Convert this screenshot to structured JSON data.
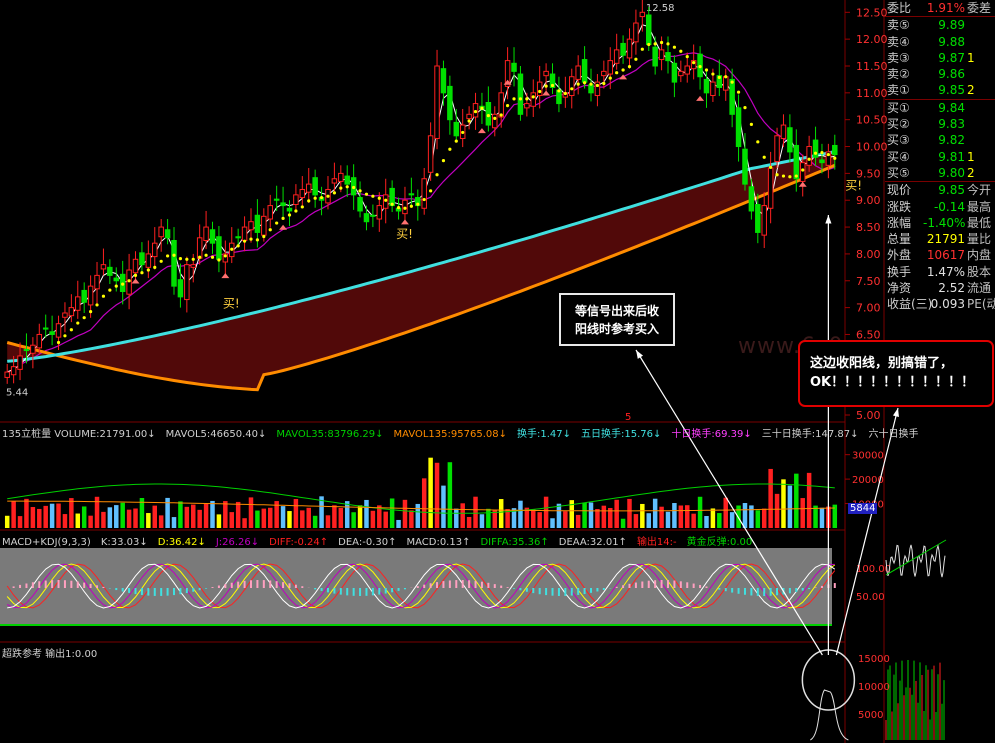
{
  "colors": {
    "up": "#ff2020",
    "down": "#00e000",
    "ma_white": "#ffffff",
    "ma_yellow": "#ffff00",
    "ma_cyan": "#40e0e0",
    "ma_orange": "#ff8c00",
    "ma_magenta": "#c000c0",
    "band_fill": "#5a0a0a",
    "macd_bg": "#7a7a7a"
  },
  "chart_data": [
    {
      "type": "line",
      "panel": "price",
      "y_axis_ticks": [
        "12.50",
        "12.00",
        "11.50",
        "11.00",
        "10.50",
        "10.00",
        "9.50",
        "9.00",
        "8.50",
        "8.00",
        "7.50",
        "7.00",
        "6.50",
        "6.00",
        "5.50",
        "5.00"
      ],
      "ylim": [
        5.0,
        12.58
      ],
      "high_label": "12.58",
      "low_label": "5.44",
      "n_bars": 139,
      "series": [
        {
          "values": [
            5.8,
            5.9,
            6.1,
            6.2,
            6.3,
            6.5,
            6.6,
            6.5,
            6.7,
            6.9,
            7.0,
            7.2,
            7.1,
            7.4,
            7.6,
            7.8,
            7.6,
            7.5,
            7.3,
            7.7,
            7.9,
            7.8,
            8.0,
            8.2,
            8.5,
            8.3,
            7.4,
            7.2,
            7.8,
            7.8,
            8.3,
            8.5,
            8.2,
            7.9,
            8.0,
            8.2,
            8.3,
            8.5,
            8.6,
            8.4,
            8.7,
            8.9,
            9.0,
            8.9,
            8.8,
            9.1,
            9.2,
            9.3,
            9.1,
            9.0,
            9.2,
            9.4,
            9.5,
            9.3,
            9.1,
            8.8,
            8.6,
            8.7,
            8.9,
            9.1,
            8.9,
            8.8,
            9.0,
            9.1,
            8.9,
            9.4,
            10.2,
            11.5,
            11.0,
            10.5,
            10.2,
            10.4,
            10.6,
            10.8,
            10.7,
            10.4,
            10.6,
            11.0,
            11.6,
            11.4,
            10.6,
            10.8,
            11.0,
            11.2,
            11.4,
            11.1,
            10.8,
            11.0,
            11.3,
            11.5,
            11.2,
            11.0,
            11.2,
            11.4,
            11.6,
            11.8,
            11.7,
            12.0,
            12.3,
            12.5,
            11.9,
            11.5,
            11.8,
            11.6,
            11.2,
            11.4,
            11.5,
            11.6,
            11.3,
            11.0,
            11.2,
            11.1,
            11.3,
            10.6,
            10.0,
            9.3,
            8.8,
            8.4,
            8.9,
            9.6,
            10.2,
            10.4,
            9.9,
            9.4,
            9.7,
            10.0,
            9.8,
            9.7,
            9.9,
            9.85
          ]
        }
      ],
      "annotations": [
        "买!",
        "买!",
        "买!"
      ]
    },
    {
      "type": "bar",
      "panel": "volume",
      "y_axis_ticks": [
        "30000",
        "20000",
        "10000"
      ]
    },
    {
      "type": "line",
      "panel": "macd_kdj",
      "y_axis_ticks": [
        "100.00",
        "50.00"
      ]
    }
  ],
  "quote": {
    "rows": [
      {
        "label": "委比",
        "value": "1.91%",
        "extra": "委差",
        "vcolor": "red"
      },
      {
        "label": "卖⑤",
        "value": "9.89",
        "extra": "",
        "vcolor": "green"
      },
      {
        "label": "卖④",
        "value": "9.88",
        "extra": "",
        "vcolor": "green"
      },
      {
        "label": "卖③",
        "value": "9.87",
        "extra": "1",
        "vcolor": "green"
      },
      {
        "label": "卖②",
        "value": "9.86",
        "extra": "",
        "vcolor": "green"
      },
      {
        "label": "卖①",
        "value": "9.85",
        "extra": "2",
        "vcolor": "green"
      },
      {
        "label": "买①",
        "value": "9.84",
        "extra": "",
        "vcolor": "green"
      },
      {
        "label": "买②",
        "value": "9.83",
        "extra": "",
        "vcolor": "green"
      },
      {
        "label": "买③",
        "value": "9.82",
        "extra": "",
        "vcolor": "green"
      },
      {
        "label": "买④",
        "value": "9.81",
        "extra": "1",
        "vcolor": "green"
      },
      {
        "label": "买⑤",
        "value": "9.80",
        "extra": "2",
        "vcolor": "green"
      },
      {
        "label": "现价",
        "value": "9.85",
        "extra": "今开",
        "vcolor": "green"
      },
      {
        "label": "涨跌",
        "value": "-0.14",
        "extra": "最高",
        "vcolor": "green"
      },
      {
        "label": "涨幅",
        "value": "-1.40%",
        "extra": "最低",
        "vcolor": "green"
      },
      {
        "label": "总量",
        "value": "21791",
        "extra": "量比",
        "vcolor": "yellow"
      },
      {
        "label": "外盘",
        "value": "10617",
        "extra": "内盘",
        "vcolor": "red"
      },
      {
        "label": "换手",
        "value": "1.47%",
        "extra": "股本",
        "vcolor": "white"
      },
      {
        "label": "净资",
        "value": "2.52",
        "extra": "流通",
        "vcolor": "white"
      },
      {
        "label": "收益(三)",
        "value": "0.093",
        "extra": "PE(动",
        "vcolor": "white"
      }
    ]
  },
  "volume_header": [
    {
      "text": "135立桩量 VOLUME:21791.00↓",
      "color": "#d0d0d0"
    },
    {
      "text": "MAVOL5:46650.40↓",
      "color": "#d0d0d0"
    },
    {
      "text": "MAVOL35:83796.29↓",
      "color": "#00d000"
    },
    {
      "text": "MAVOL135:95765.08↓",
      "color": "#ff8c00"
    },
    {
      "text": "换手:1.47↓",
      "color": "#40e0e0"
    },
    {
      "text": "五日换手:15.76↓",
      "color": "#40e0e0"
    },
    {
      "text": "十日换手:69.39↓",
      "color": "#ff40ff"
    },
    {
      "text": "三十日换手:147.87↓",
      "color": "#d0d0d0"
    },
    {
      "text": "六十日换手",
      "color": "#d0d0d0"
    }
  ],
  "macd_header": [
    {
      "text": "MACD+KDJ(9,3,3)",
      "color": "#d0d0d0"
    },
    {
      "text": "K:33.03↓",
      "color": "#d0d0d0"
    },
    {
      "text": "D:36.42↓",
      "color": "#ffff00"
    },
    {
      "text": "J:26.26↓",
      "color": "#c000c0"
    },
    {
      "text": "DIFF:-0.24↑",
      "color": "#ff2020"
    },
    {
      "text": "DEA:-0.30↑",
      "color": "#d0d0d0"
    },
    {
      "text": "MACD:0.13↑",
      "color": "#d0d0d0"
    },
    {
      "text": "DIFFA:35.36↑",
      "color": "#00d000"
    },
    {
      "text": "DEAA:32.01↑",
      "color": "#d0d0d0"
    },
    {
      "text": "输出14:-",
      "color": "#ff2020"
    },
    {
      "text": "黄金反弹:0.00",
      "color": "#00d000"
    }
  ],
  "bottom_header": {
    "text": "超跌参考 输出1:0.00"
  },
  "marker_5": "5",
  "small_label": "5844",
  "callouts": {
    "left_line1": "等信号出来后收",
    "left_line2": "阳线时参考买入",
    "right_line1": "这边收阳线，别搞错了，",
    "right_line2": "OK！！！！！！！！！！！"
  },
  "watermark": "www.6z0.com"
}
